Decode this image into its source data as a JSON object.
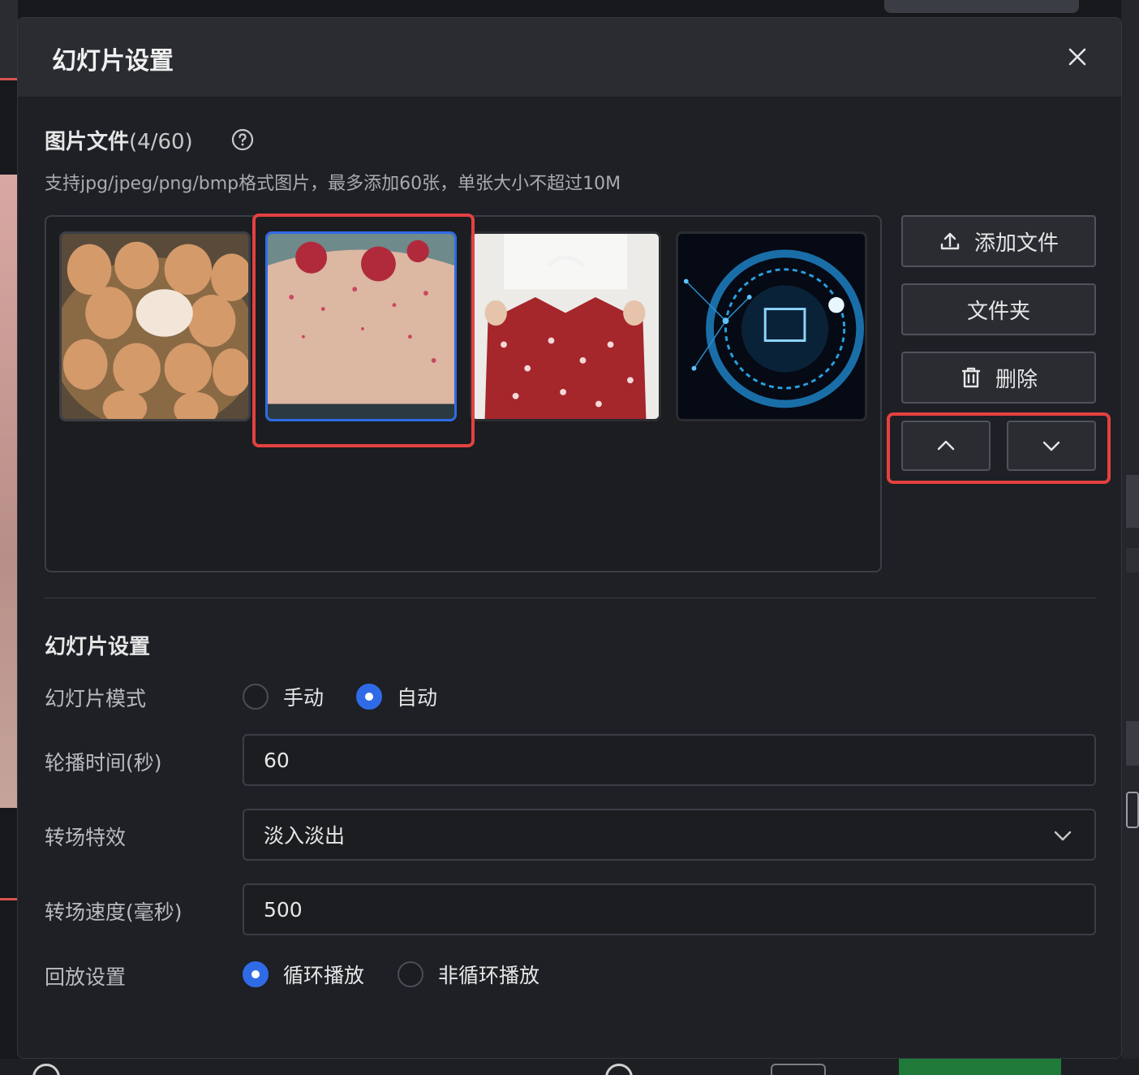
{
  "dialog": {
    "title": "幻灯片设置",
    "close_icon": "close-icon"
  },
  "images": {
    "title": "图片文件",
    "count": "(4/60)",
    "hint": "支持jpg/jpeg/png/bmp格式图片，最多添加60张，单张大小不超过10M",
    "help_icon": "question-circle-icon",
    "thumbnails": [
      {
        "subject": "eggs-in-basket",
        "selected": false
      },
      {
        "subject": "rose-cake",
        "selected": true
      },
      {
        "subject": "red-polka-dot-shirt",
        "selected": false
      },
      {
        "subject": "tech-shopping-cart",
        "selected": false
      }
    ],
    "selection_color": "#2f6be6"
  },
  "actions": {
    "add_file": "添加文件",
    "folder": "文件夹",
    "delete": "删除",
    "move_up_icon": "chevron-up-icon",
    "move_down_icon": "chevron-down-icon"
  },
  "slideshow": {
    "section_title": "幻灯片设置",
    "mode_label": "幻灯片模式",
    "mode_options": [
      "手动",
      "自动"
    ],
    "mode_selected": "自动",
    "interval_label": "轮播时间(秒)",
    "interval_value": "60",
    "transition_label": "转场特效",
    "transition_value": "淡入淡出",
    "speed_label": "转场速度(毫秒)",
    "speed_value": "500",
    "playback_label": "回放设置",
    "playback_options": [
      "循环播放",
      "非循环播放"
    ],
    "playback_selected": "循环播放"
  },
  "colors": {
    "accent": "#2f6be6",
    "highlight": "#e4413f",
    "background": "#1e2025"
  }
}
